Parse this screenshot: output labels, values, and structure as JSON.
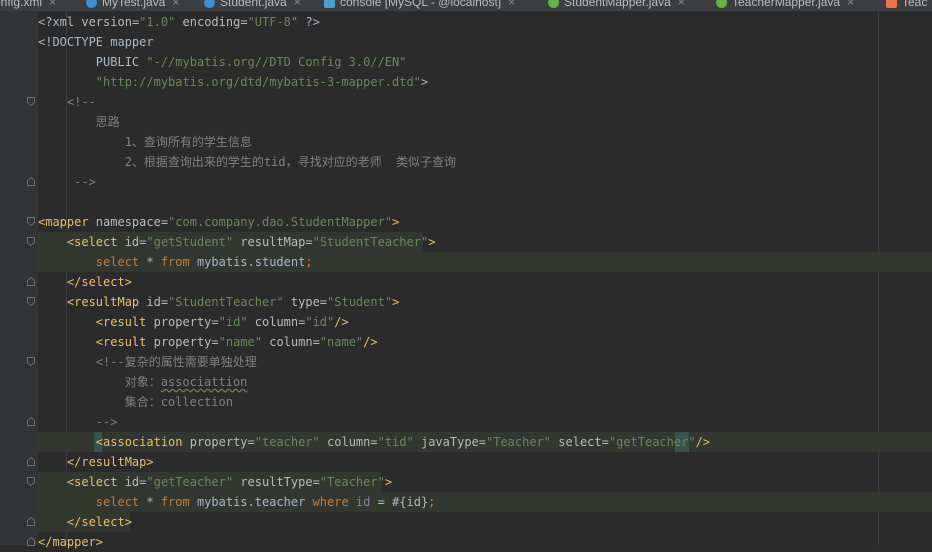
{
  "colors": {
    "background": "#2b2b2b",
    "tag": "#e8bf6a",
    "attribute": "#bababa",
    "value": "#6a8759",
    "comment": "#808080",
    "keyword": "#cc7832",
    "column": "#9876aa",
    "text": "#a9b7c6",
    "highlight": "#32372f"
  },
  "tabs": [
    {
      "label": "config.xml",
      "icon": "xml-file-icon",
      "icon_color": "#e8754a"
    },
    {
      "label": "MyTest.java",
      "icon": "java-class-icon",
      "icon_color": "#3d8fd1"
    },
    {
      "label": "Student.java",
      "icon": "java-class-icon",
      "icon_color": "#3d8fd1"
    },
    {
      "label": "console [MySQL - @localhost]",
      "icon": "database-console-icon",
      "icon_color": "#4a9fd1"
    },
    {
      "label": "StudentMapper.java",
      "icon": "java-interface-icon",
      "icon_color": "#62b543"
    },
    {
      "label": "TeacherMapper.java",
      "icon": "java-interface-icon",
      "icon_color": "#62b543"
    },
    {
      "label": "Teac",
      "icon": "xml-file-icon",
      "icon_color": "#e8754a"
    }
  ],
  "tab_close_glyph": "×",
  "editor": {
    "lines": [
      [
        [
          "t-txt",
          "<?xml "
        ],
        [
          "t-attr",
          "version"
        ],
        [
          "t-txt",
          "="
        ],
        [
          "t-val",
          "\"1.0\""
        ],
        [
          "t-txt",
          " "
        ],
        [
          "t-attr",
          "encoding"
        ],
        [
          "t-txt",
          "="
        ],
        [
          "t-val",
          "\"UTF-8\""
        ],
        [
          "t-txt",
          " ?>"
        ]
      ],
      [
        [
          "t-txt",
          "<!DOCTYPE mapper"
        ]
      ],
      [
        [
          "t-txt",
          "        PUBLIC "
        ],
        [
          "t-val",
          "\"-//mybatis.org//DTD Config 3.0//EN\""
        ]
      ],
      [
        [
          "t-val",
          "        \"http://mybatis.org/dtd/mybatis-3-mapper.dtd\""
        ],
        [
          "t-txt",
          ">"
        ]
      ],
      [
        [
          "t-com",
          "    <!--"
        ]
      ],
      [
        [
          "t-com",
          "        思路"
        ]
      ],
      [
        [
          "t-com",
          "            1、查询所有的学生信息"
        ]
      ],
      [
        [
          "t-com",
          "            2、根据查询出来的学生的tid，寻找对应的老师  类似子查询"
        ]
      ],
      [
        [
          "t-com",
          "     -->"
        ]
      ],
      [],
      [
        [
          "t-tag",
          "<mapper "
        ],
        [
          "t-attr",
          "namespace"
        ],
        [
          "t-txt",
          "="
        ],
        [
          "t-val",
          "\"com.company.dao.StudentMapper\""
        ],
        [
          "t-tag",
          ">"
        ]
      ],
      [
        [
          "t-tag",
          "    <select "
        ],
        [
          "t-attr",
          "id"
        ],
        [
          "t-txt",
          "="
        ],
        [
          "t-val",
          "\"getStudent\""
        ],
        [
          "t-txt",
          " "
        ],
        [
          "t-attr",
          "resultMap"
        ],
        [
          "t-txt",
          "="
        ],
        [
          "t-val",
          "\"StudentTeacher\""
        ],
        [
          "t-tag",
          ">"
        ]
      ],
      [
        [
          "t-kw",
          "        select "
        ],
        [
          "t-txt",
          "* "
        ],
        [
          "t-kw",
          "from "
        ],
        [
          "t-txt",
          "mybatis.student"
        ],
        [
          "t-kw",
          ";"
        ]
      ],
      [
        [
          "t-tag",
          "    </select>"
        ]
      ],
      [
        [
          "t-tag",
          "    <resultMap "
        ],
        [
          "t-attr",
          "id"
        ],
        [
          "t-txt",
          "="
        ],
        [
          "t-val",
          "\"StudentTeacher\""
        ],
        [
          "t-txt",
          " "
        ],
        [
          "t-attr",
          "type"
        ],
        [
          "t-txt",
          "="
        ],
        [
          "t-val",
          "\"Student\""
        ],
        [
          "t-tag",
          ">"
        ]
      ],
      [
        [
          "t-tag",
          "        <result "
        ],
        [
          "t-attr",
          "property"
        ],
        [
          "t-txt",
          "="
        ],
        [
          "t-val",
          "\"id\""
        ],
        [
          "t-txt",
          " "
        ],
        [
          "t-attr",
          "column"
        ],
        [
          "t-txt",
          "="
        ],
        [
          "t-val",
          "\"id\""
        ],
        [
          "t-tag",
          "/>"
        ]
      ],
      [
        [
          "t-tag",
          "        <result "
        ],
        [
          "t-attr",
          "property"
        ],
        [
          "t-txt",
          "="
        ],
        [
          "t-val",
          "\"name\""
        ],
        [
          "t-txt",
          " "
        ],
        [
          "t-attr",
          "column"
        ],
        [
          "t-txt",
          "="
        ],
        [
          "t-val",
          "\"name\""
        ],
        [
          "t-tag",
          "/>"
        ]
      ],
      [
        [
          "t-com",
          "        <!--复杂的属性需要单独处理"
        ]
      ],
      [
        [
          "t-com",
          "            对象："
        ],
        [
          "t-com squig",
          "associattion"
        ]
      ],
      [
        [
          "t-com",
          "            集合：collection"
        ]
      ],
      [
        [
          "t-com",
          "        -->"
        ]
      ],
      [
        [
          "t-tag",
          "        <association "
        ],
        [
          "t-attr",
          "property"
        ],
        [
          "t-txt",
          "="
        ],
        [
          "t-val",
          "\"teacher\""
        ],
        [
          "t-txt",
          " "
        ],
        [
          "t-attr",
          "column"
        ],
        [
          "t-txt",
          "="
        ],
        [
          "t-val",
          "\"tid\""
        ],
        [
          "t-txt",
          " "
        ],
        [
          "t-attr",
          "javaType"
        ],
        [
          "t-txt",
          "="
        ],
        [
          "t-val",
          "\"Teacher\""
        ],
        [
          "t-txt",
          " "
        ],
        [
          "t-attr",
          "select"
        ],
        [
          "t-txt",
          "="
        ],
        [
          "t-val",
          "\"getTeacher\""
        ],
        [
          "t-tag",
          "/>"
        ]
      ],
      [
        [
          "t-tag",
          "    </resultMap>"
        ]
      ],
      [
        [
          "t-tag",
          "    <select "
        ],
        [
          "t-attr",
          "id"
        ],
        [
          "t-txt",
          "="
        ],
        [
          "t-val",
          "\"getTeacher\""
        ],
        [
          "t-txt",
          " "
        ],
        [
          "t-attr",
          "resultType"
        ],
        [
          "t-txt",
          "="
        ],
        [
          "t-val",
          "\"Teacher\""
        ],
        [
          "t-tag",
          ">"
        ]
      ],
      [
        [
          "t-kw",
          "        select "
        ],
        [
          "t-txt",
          "* "
        ],
        [
          "t-kw",
          "from "
        ],
        [
          "t-txt",
          "mybatis.teacher "
        ],
        [
          "t-kw",
          "where "
        ],
        [
          "t-col",
          "id "
        ],
        [
          "t-txt",
          "= #{id}"
        ],
        [
          "t-kw",
          ";"
        ]
      ],
      [
        [
          "t-tag",
          "    </select>"
        ]
      ],
      [
        [
          "t-tag",
          "</mapper>"
        ]
      ]
    ]
  }
}
